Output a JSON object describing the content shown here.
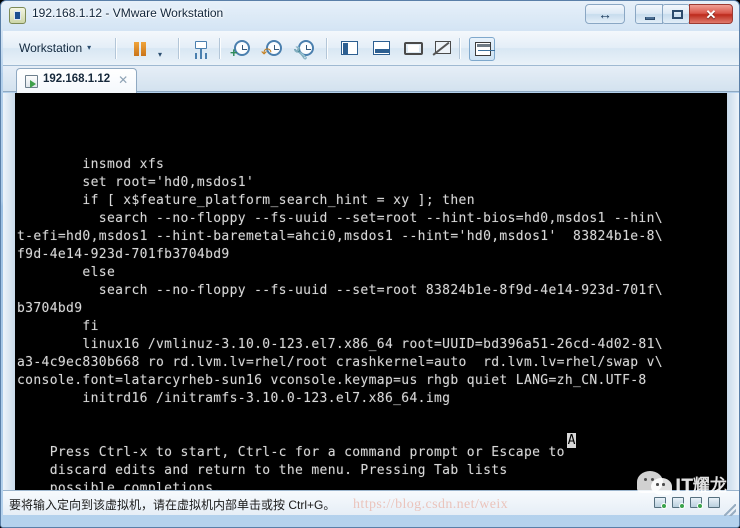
{
  "window": {
    "title": "192.168.1.12 - VMware Workstation",
    "app_icon": "vmware-app-icon",
    "controls": {
      "restore_arrow": "↔",
      "minimize": "minimize",
      "maximize": "maximize",
      "close": "✕"
    }
  },
  "toolbar": {
    "menu_label": "Workstation",
    "caret": "▾",
    "buttons": [
      {
        "name": "pause-vm-button",
        "icon": "pause-icon"
      },
      {
        "name": "power-options-dropdown",
        "icon": "chevron-down-icon"
      },
      {
        "name": "manage-snapshots-button",
        "icon": "snapshot-manager-icon"
      },
      {
        "name": "take-snapshot-button",
        "icon": "clock-plus-icon"
      },
      {
        "name": "revert-snapshot-button",
        "icon": "clock-revert-icon"
      },
      {
        "name": "snapshot-manager-button",
        "icon": "clock-wrench-icon"
      },
      {
        "name": "show-library-button",
        "icon": "sidebar-panel-icon"
      },
      {
        "name": "show-console-view-button",
        "icon": "bottom-panel-icon"
      },
      {
        "name": "enter-fullscreen-button",
        "icon": "fullscreen-icon"
      },
      {
        "name": "unity-mode-button",
        "icon": "unity-mode-icon"
      },
      {
        "name": "console-view-button",
        "icon": "console-view-icon"
      }
    ]
  },
  "tab": {
    "label": "192.168.1.12",
    "icon": "vm-tab-icon",
    "close": "✕"
  },
  "terminal": {
    "scroll_marker": "↑",
    "cursor_char": "A",
    "lines": [
      "        insmod xfs",
      "        set root='hd0,msdos1'",
      "        if [ x$feature_platform_search_hint = xy ]; then",
      "          search --no-floppy --fs-uuid --set=root --hint-bios=hd0,msdos1 --hin\\",
      "t-efi=hd0,msdos1 --hint-baremetal=ahci0,msdos1 --hint='hd0,msdos1'  83824b1e-8\\",
      "f9d-4e14-923d-701fb3704bd9",
      "        else",
      "          search --no-floppy --fs-uuid --set=root 83824b1e-8f9d-4e14-923d-701f\\",
      "b3704bd9",
      "        fi",
      "        linux16 /vmlinuz-3.10.0-123.el7.x86_64 root=UUID=bd396a51-26cd-4d02-81\\",
      "a3-4c9ec830b668 ro rd.lvm.lv=rhel/root crashkernel=auto  rd.lvm.lv=rhel/swap v\\",
      "console.font=latarcyrheb-sun16 vconsole.keymap=us rhgb quiet LANG=zh_CN.UTF-8",
      "        initrd16 /initramfs-3.10.0-123.el7.x86_64.img",
      "",
      "",
      "    Press Ctrl-x to start, Ctrl-c for a command prompt or Escape to",
      "    discard edits and return to the menu. Pressing Tab lists",
      "    possible completions."
    ]
  },
  "statusbar": {
    "message": "要将输入定向到该虚拟机，请在虚拟机内部单击或按 Ctrl+G。",
    "devices": [
      {
        "name": "status-hard-disk-icon"
      },
      {
        "name": "status-network-icon"
      },
      {
        "name": "status-usb-icon"
      },
      {
        "name": "status-printer-icon"
      }
    ]
  },
  "watermark": {
    "url": "https://blog.csdn.net/weix",
    "account_name": "IT耀龙",
    "logo": "wechat-logo"
  },
  "colors": {
    "terminal_bg": "#000000",
    "terminal_fg": "#d8d8d8",
    "titlebar_accent": "#9cc0e3",
    "close_button": "#d9564a"
  }
}
